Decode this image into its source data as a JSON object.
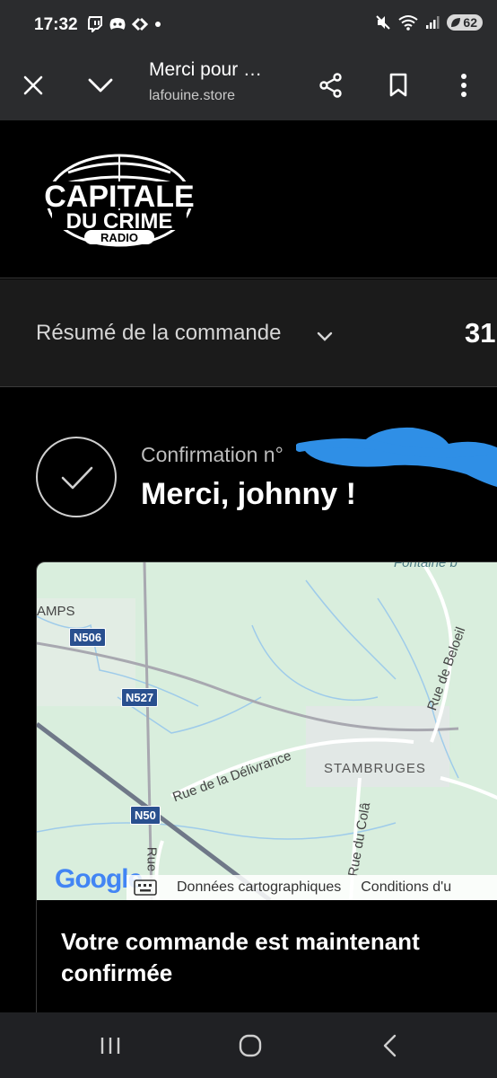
{
  "status_bar": {
    "time": "17:32",
    "left_icons": [
      "twitch-icon",
      "discord-icon",
      "carrefour-icon",
      "dot-icon"
    ],
    "right_icons": [
      "mute-icon",
      "wifi-icon",
      "signal-icon"
    ],
    "battery": "62"
  },
  "browser": {
    "page_title": "Merci pour …",
    "url": "lafouine.store",
    "icons": [
      "close-icon",
      "chevron-down-icon",
      "share-icon",
      "bookmark-icon",
      "more-icon"
    ]
  },
  "site": {
    "logo_line1": "CAPITALE",
    "logo_line2": "DU CRIME",
    "logo_line3": "RADIO"
  },
  "summary": {
    "label": "Résumé de la commande",
    "total": "31"
  },
  "confirmation": {
    "number_label": "Confirmation n°",
    "thanks": "Merci, johnny !"
  },
  "map": {
    "labels": {
      "amps": "AMPS",
      "fontaine": "Fontaine b",
      "rue_beloeil": "Rue de Beloeil",
      "rue_delivrance": "Rue de la Délivrance",
      "stambruges": "STAMBRUGES",
      "rue_du_cola": "Rue du Colâ",
      "rue_left": "Rue"
    },
    "roads": [
      "N506",
      "N527",
      "N50"
    ],
    "google": "Google",
    "footer_data": "Données cartographiques",
    "footer_terms": "Conditions d'u"
  },
  "card": {
    "title": "Votre commande est maintenant confirmée"
  },
  "colors": {
    "background": "#000000",
    "chrome": "#2b2c2e",
    "summary_bg": "#1b1b1b",
    "map_bg": "#d9eedd",
    "road_badge": "#29508f",
    "redaction": "#2f8fe6"
  }
}
